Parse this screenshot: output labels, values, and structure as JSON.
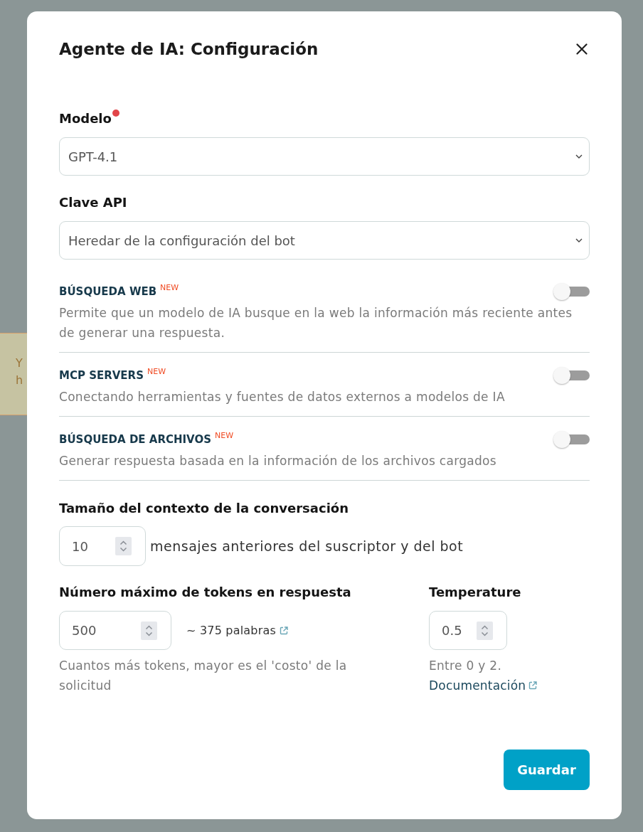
{
  "background": {
    "notice_lines": [
      "Y",
      "h"
    ]
  },
  "dialog": {
    "title": "Agente de IA: Configuración"
  },
  "fields": [
    {
      "label": "Modelo",
      "required": true,
      "value": "GPT-4.1"
    },
    {
      "label": "Clave API",
      "required": false,
      "value": "Heredar de la configuración del bot"
    }
  ],
  "features": [
    {
      "title": "BÚSQUEDA WEB",
      "badge": "NEW",
      "on": false,
      "description": "Permite que un modelo de IA busque en la web la información más reciente antes de generar una respuesta."
    },
    {
      "title": "MCP SERVERS",
      "badge": "NEW",
      "on": false,
      "description": "Conectando herramientas y fuentes de datos externos a modelos de IA"
    },
    {
      "title": "BÚSQUEDA DE ARCHIVOS",
      "badge": "NEW",
      "on": false,
      "description": "Generar respuesta basada en la información de los archivos cargados"
    }
  ],
  "context": {
    "label": "Tamaño del contexto de la conversación",
    "value": "10",
    "suffix": "mensajes anteriores del suscriptor y del bot"
  },
  "max_tokens": {
    "label": "Número máximo de tokens en respuesta",
    "value": "500",
    "estimate": "~ 375 palabras",
    "hint": "Cuantos más tokens, mayor es el 'costo' de la solicitud"
  },
  "temperature": {
    "label": "Temperature",
    "value": "0.5",
    "hint": "Entre 0 y 2.",
    "link": "Documentación"
  },
  "footer": {
    "save_button": "Guardar"
  }
}
